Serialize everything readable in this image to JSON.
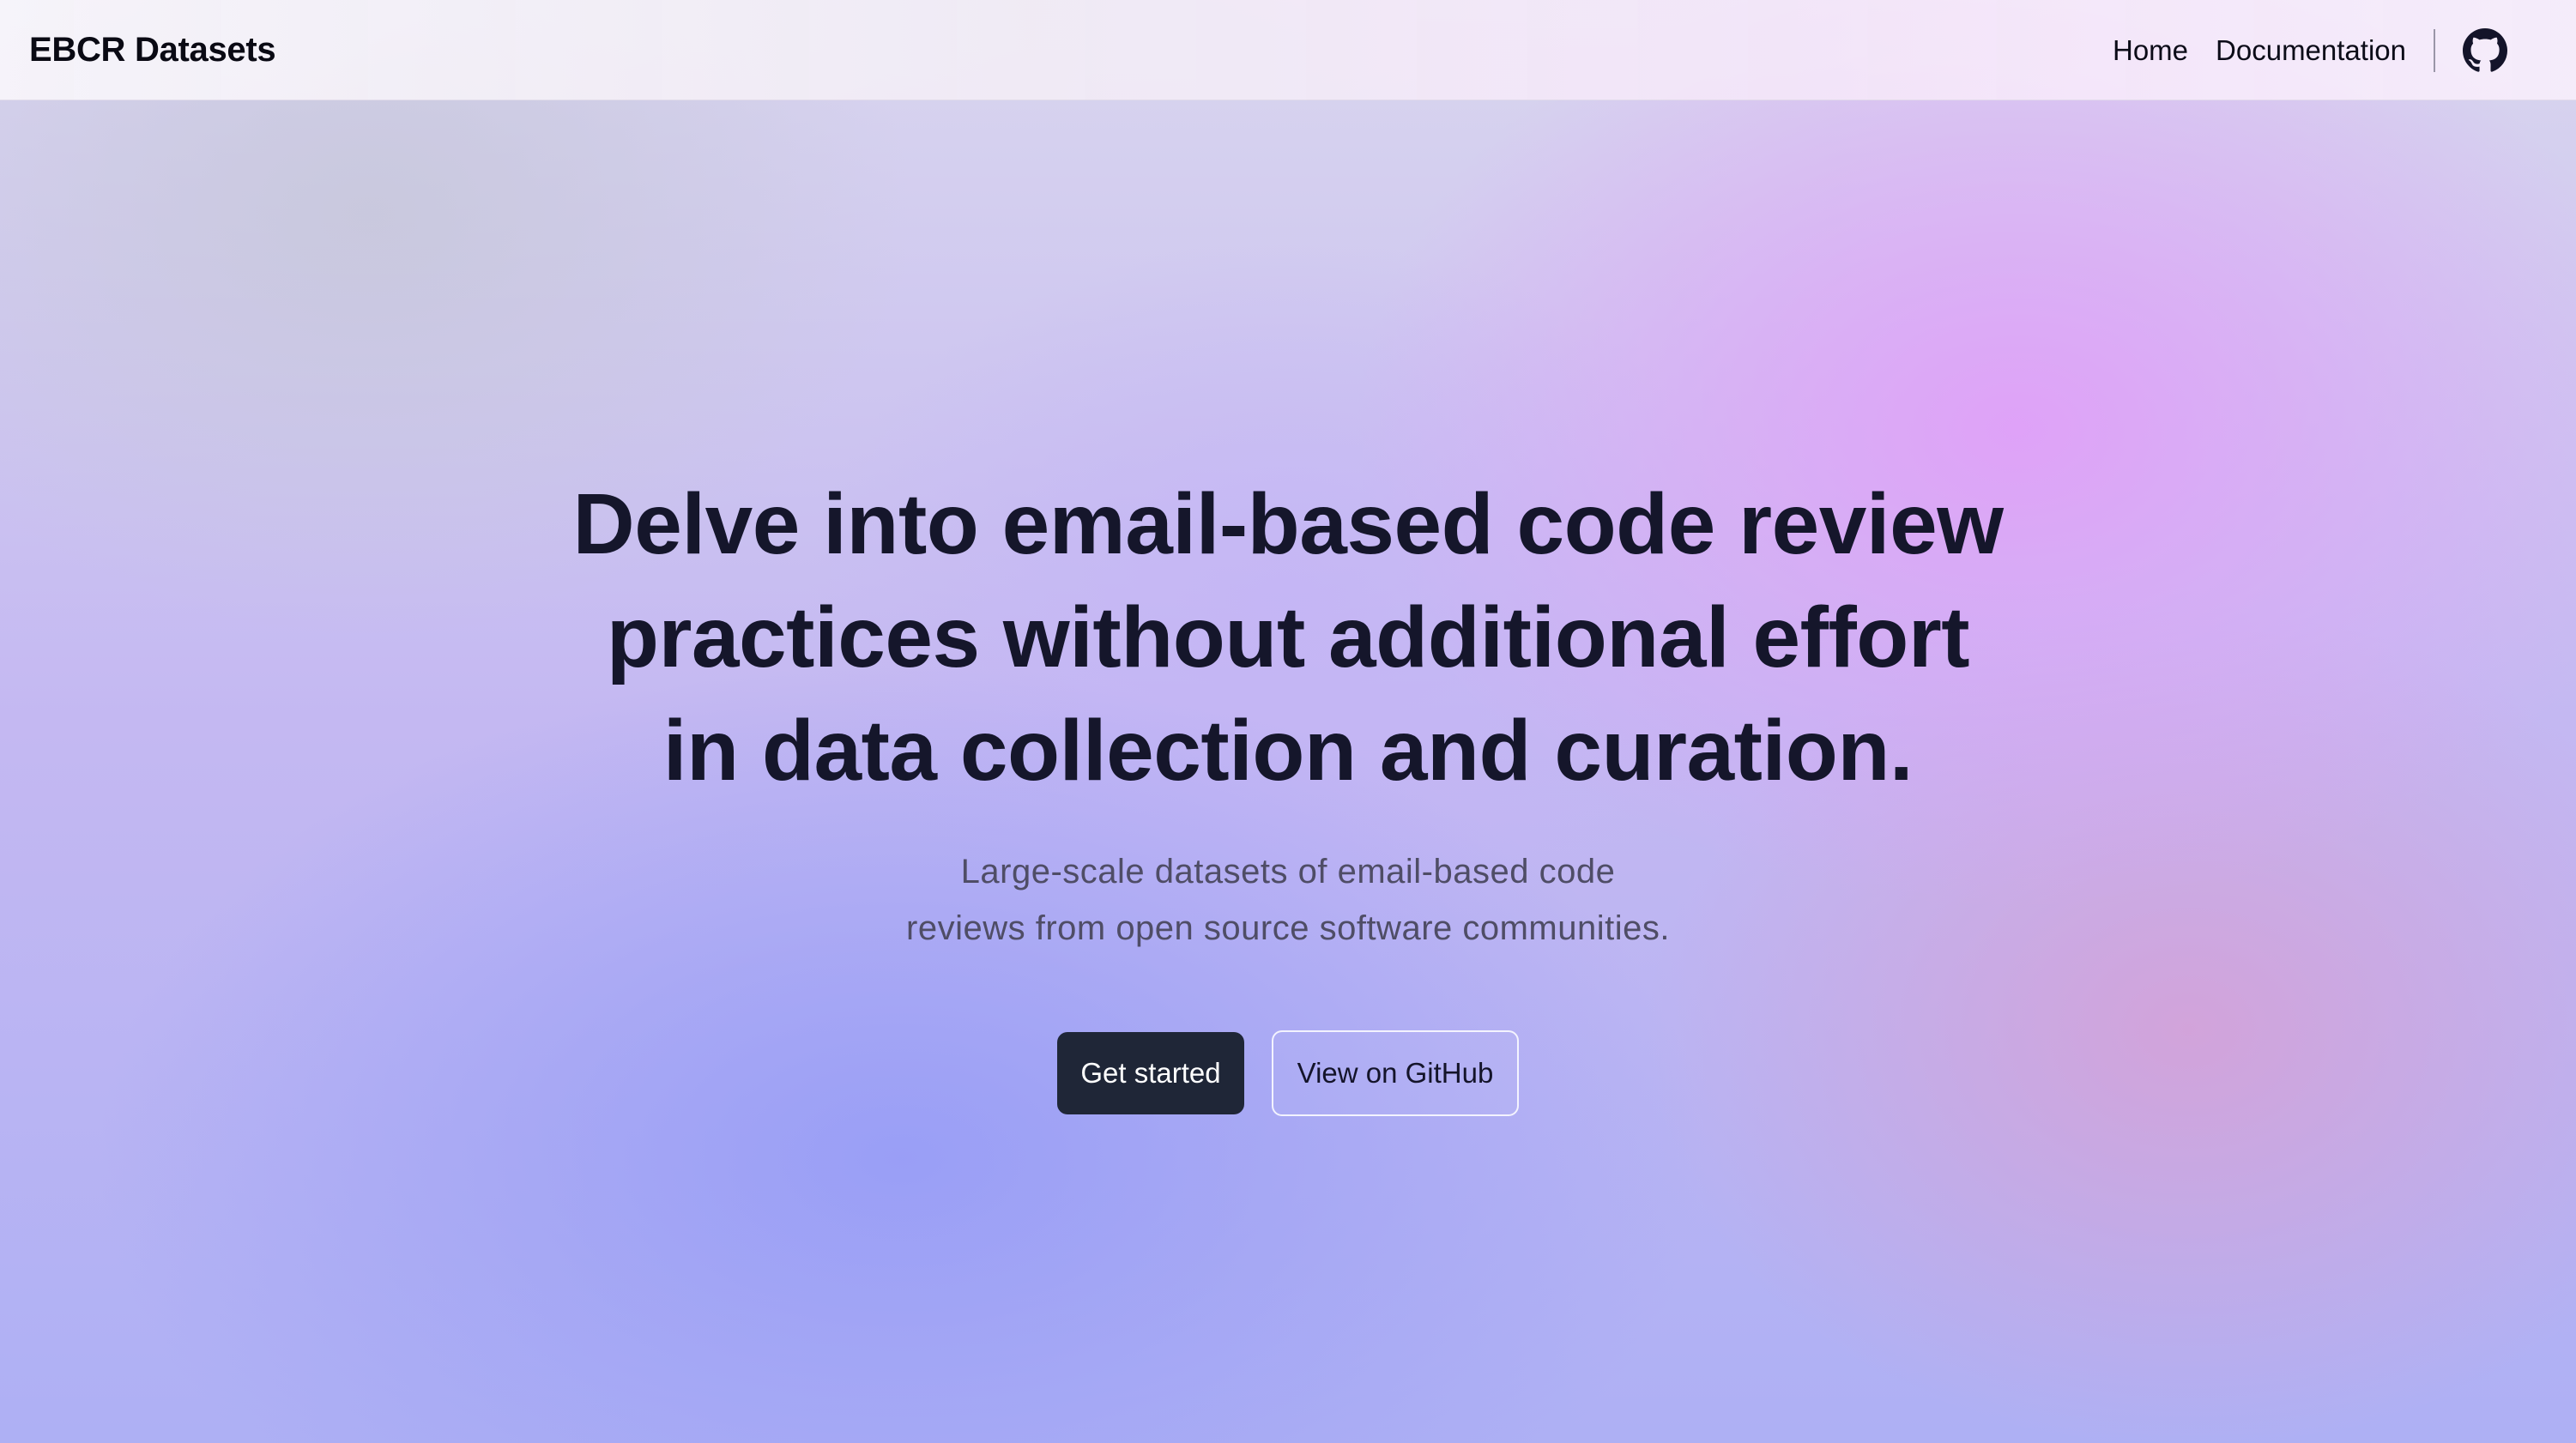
{
  "header": {
    "brand": "EBCR Datasets",
    "nav": {
      "home": "Home",
      "documentation": "Documentation"
    },
    "github_icon": "github-icon"
  },
  "hero": {
    "title_line1": "Delve into email-based code review",
    "title_line2": "practices without additional effort",
    "title_line3": "in data collection and curation.",
    "subtitle_line1": "Large-scale datasets of email-based code",
    "subtitle_line2": "reviews from open source software communities.",
    "primary_button": "Get started",
    "secondary_button": "View on GitHub"
  },
  "colors": {
    "text_dark": "#15162b",
    "button_primary": "#1f2637",
    "subtitle": "#4f4d66"
  }
}
